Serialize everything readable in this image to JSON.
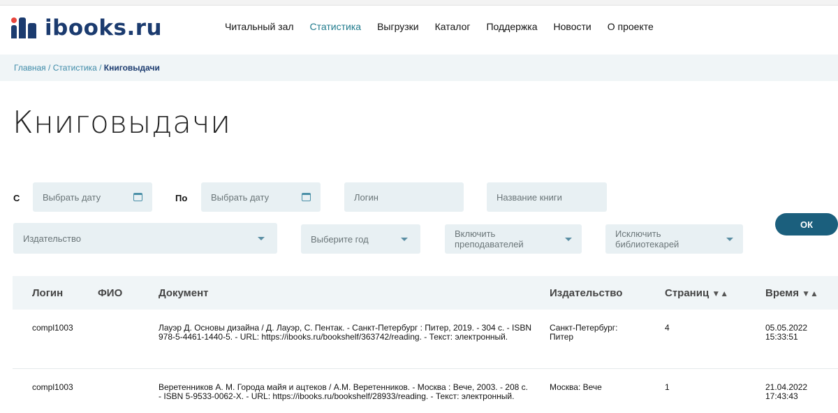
{
  "app": {
    "logo_text": "ibooks.ru"
  },
  "nav": {
    "items": [
      {
        "label": "Читальный зал",
        "active": false
      },
      {
        "label": "Статистика",
        "active": true
      },
      {
        "label": "Выгрузки",
        "active": false
      },
      {
        "label": "Каталог",
        "active": false
      },
      {
        "label": "Поддержка",
        "active": false
      },
      {
        "label": "Новости",
        "active": false
      },
      {
        "label": "О проекте",
        "active": false
      }
    ]
  },
  "breadcrumb": {
    "home": "Главная",
    "section": "Статистика",
    "current": "Книговыдачи",
    "separator": "/"
  },
  "page": {
    "title": "Книговыдачи"
  },
  "filters": {
    "from_label": "С",
    "to_label": "По",
    "date_from_placeholder": "Выбрать дату",
    "date_to_placeholder": "Выбрать дату",
    "login_placeholder": "Логин",
    "book_placeholder": "Название книги",
    "publisher_placeholder": "Издательство",
    "year_placeholder": "Выберите год",
    "include_teachers": "Включить преподавателей",
    "exclude_librarians": "Исключить библиотекарей",
    "ok_label": "ОК"
  },
  "table": {
    "headers": {
      "login": "Логин",
      "fio": "ФИО",
      "document": "Документ",
      "publisher": "Издательство",
      "pages": "Страниц",
      "time": "Время"
    },
    "sort_glyphs": "▼▲",
    "rows": [
      {
        "login": "compl1003",
        "fio": "",
        "document": "Лауэр Д. Основы дизайна / Д. Лауэр, С. Пентак. - Санкт-Петербург : Питер, 2019. - 304 с. - ISBN 978-5-4461-1440-5. - URL: https://ibooks.ru/bookshelf/363742/reading. - Текст: электронный.",
        "publisher": "Санкт-Петербург: Питер",
        "pages": "4",
        "date": "05.05.2022",
        "time": "15:33:51"
      },
      {
        "login": "compl1003",
        "fio": "",
        "document": "Веретенников А. М. Города майя и ацтеков / А.М. Веретенников. - Москва : Вече, 2003. - 208 с. - ISBN 5-9533-0062-X. - URL: https://ibooks.ru/bookshelf/28933/reading. - Текст: электронный.",
        "publisher": "Москва: Вече",
        "pages": "1",
        "date": "21.04.2022",
        "time": "17:43:43"
      }
    ]
  },
  "colors": {
    "brand": "#1b3b6f",
    "accent": "#1f7a8c",
    "logo_dot": "#e8453c",
    "button": "#1b5f7d",
    "field_bg": "#e8f0f3"
  },
  "icons": {
    "calendar": "calendar-icon",
    "dropdown": "chevron-down-icon",
    "sort": "sort-icon"
  }
}
